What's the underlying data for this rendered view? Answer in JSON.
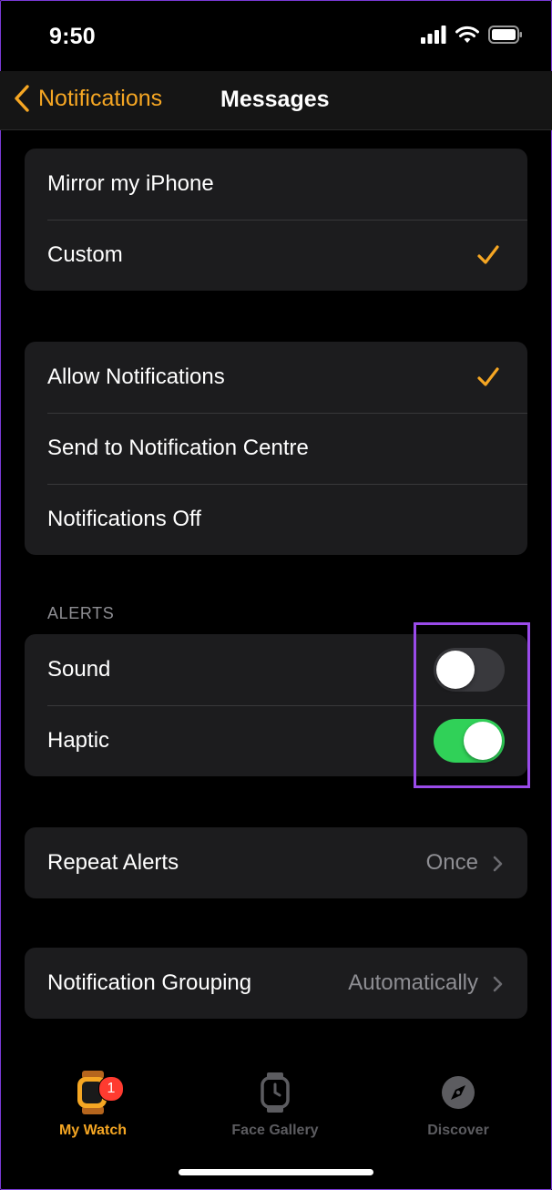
{
  "status_bar": {
    "time": "9:50"
  },
  "nav": {
    "back_label": "Notifications",
    "title": "Messages"
  },
  "mirror_group": {
    "items": [
      {
        "label": "Mirror my iPhone",
        "checked": false
      },
      {
        "label": "Custom",
        "checked": true
      }
    ]
  },
  "notif_group": {
    "items": [
      {
        "label": "Allow Notifications",
        "checked": true
      },
      {
        "label": "Send to Notification Centre",
        "checked": false
      },
      {
        "label": "Notifications Off",
        "checked": false
      }
    ]
  },
  "alerts": {
    "header": "ALERTS",
    "sound": {
      "label": "Sound",
      "on": false
    },
    "haptic": {
      "label": "Haptic",
      "on": true
    }
  },
  "repeat_alerts": {
    "label": "Repeat Alerts",
    "value": "Once"
  },
  "grouping": {
    "label": "Notification Grouping",
    "value": "Automatically"
  },
  "tabs": [
    {
      "label": "My Watch",
      "active": true,
      "badge": "1",
      "icon": "watch-icon"
    },
    {
      "label": "Face Gallery",
      "active": false,
      "icon": "watch-face-icon"
    },
    {
      "label": "Discover",
      "active": false,
      "icon": "compass-icon"
    }
  ],
  "colors": {
    "accent": "#f5a623",
    "toggle_on": "#30d158",
    "highlight": "#9a4bea",
    "badge": "#ff3b30"
  }
}
